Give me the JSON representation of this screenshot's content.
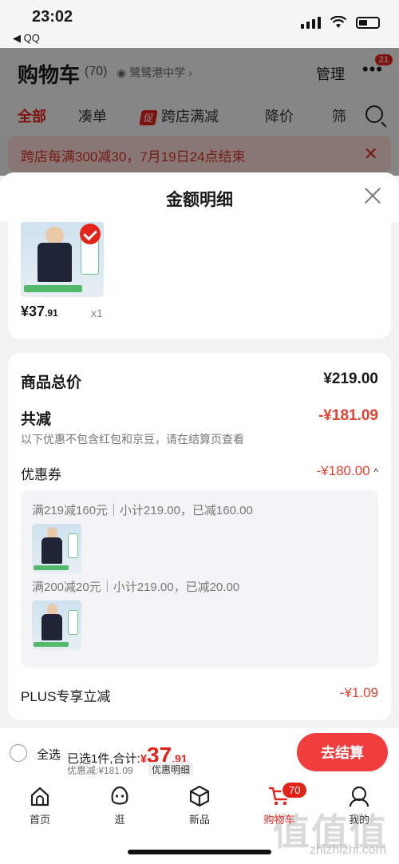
{
  "status_bar": {
    "time": "23:02",
    "back_app": "◀ QQ"
  },
  "header": {
    "title": "购物车",
    "count": "(70)",
    "location": "鹭鹭港中学",
    "manage_label": "管理",
    "more_badge": "21"
  },
  "tabs": [
    {
      "label": "全部"
    },
    {
      "label": "凑单"
    },
    {
      "label": "跨店满减",
      "tag": "促"
    },
    {
      "label": "降价"
    },
    {
      "label": "筛"
    }
  ],
  "notice": {
    "text": "跨店每满300减30，7月19日24点结束"
  },
  "sheet": {
    "title": "金额明细",
    "item": {
      "price_int": "¥37",
      "price_dec": ".91",
      "qty": "x1"
    },
    "total_label": "商品总价",
    "total_value": "¥219.00",
    "saved_label": "共减",
    "saved_value": "-¥181.09",
    "saved_note": "以下优惠不包含红包和京豆，请在结算页查看",
    "coupon_label": "优惠券",
    "coupon_value": "-¥180.00",
    "coupons": [
      {
        "text": "满219减160元｜小计219.00，已减160.00"
      },
      {
        "text": "满200减20元｜小计219.00，已减20.00"
      }
    ],
    "plus_label": "PLUS专享立减",
    "plus_value": "-¥1.09"
  },
  "bottom": {
    "select_all": "全选",
    "selected_text": "已选1件,合计:",
    "total_sym": "¥",
    "total_int": "37",
    "total_dec": ".91",
    "discount_text": "优惠减:¥181.09",
    "detail_label": "优惠明细",
    "checkout_label": "去结算"
  },
  "tabbar": [
    {
      "label": "首页",
      "icon": "home-icon"
    },
    {
      "label": "逛",
      "icon": "explore-icon"
    },
    {
      "label": "新品",
      "icon": "new-product-icon"
    },
    {
      "label": "购物车",
      "icon": "cart-icon",
      "badge": "70"
    },
    {
      "label": "我的",
      "icon": "profile-icon"
    }
  ],
  "watermark": {
    "text": "值值值",
    "url": "zhizhizhi.com"
  },
  "colors": {
    "accent": "#e2231a",
    "discount": "#e2412f",
    "checkout": "#f23d3d"
  }
}
